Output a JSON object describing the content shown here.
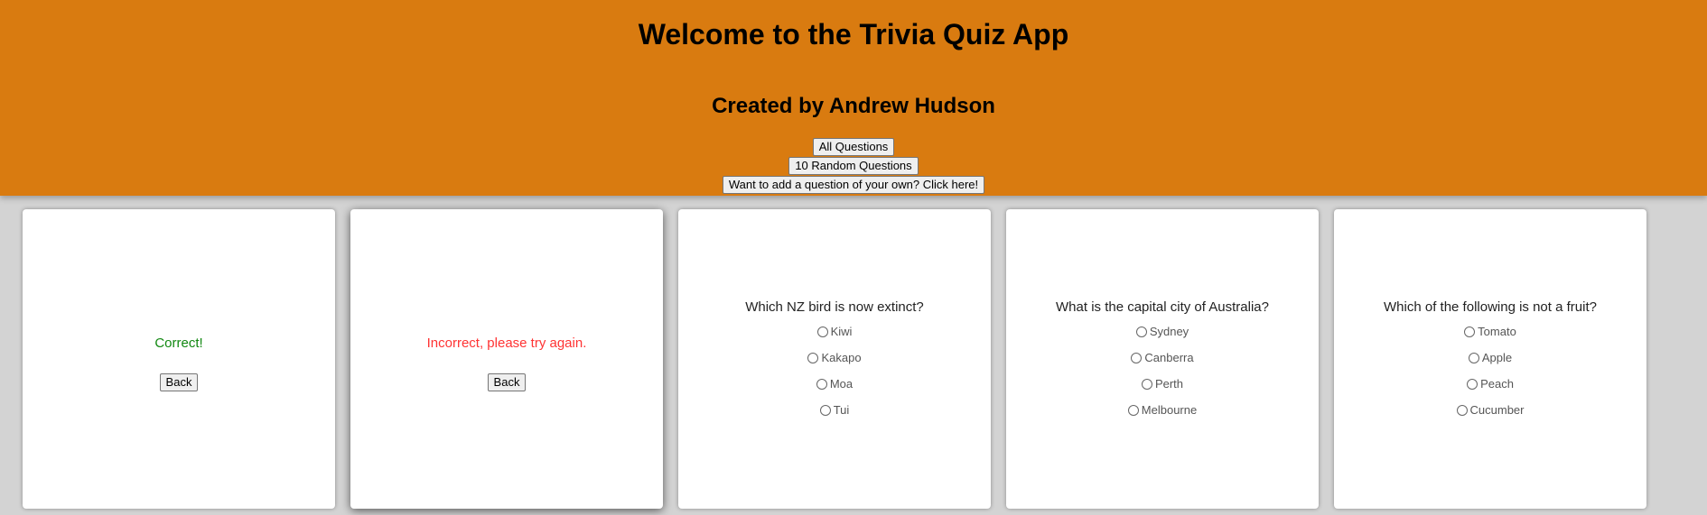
{
  "header": {
    "title": "Welcome to the Trivia Quiz App",
    "subtitle": "Created by Andrew Hudson",
    "buttons": [
      "All Questions",
      "10 Random Questions",
      "Want to add a question of your own? Click here!"
    ]
  },
  "colors": {
    "header_bg": "#d97b10",
    "page_bg": "#d3d3d3",
    "correct": "#118811",
    "incorrect": "#ff3333"
  },
  "cards": [
    {
      "result": "Correct!",
      "back": "Back"
    },
    {
      "result": "Incorrect, please try again.",
      "back": "Back"
    },
    {
      "question": "Which NZ bird is now extinct?",
      "options": [
        "Kiwi",
        "Kakapo",
        "Moa",
        "Tui"
      ]
    },
    {
      "question": "What is the capital city of Australia?",
      "options": [
        "Sydney",
        "Canberra",
        "Perth",
        "Melbourne"
      ]
    },
    {
      "question": "Which of the following is not a fruit?",
      "options": [
        "Tomato",
        "Apple",
        "Peach",
        "Cucumber"
      ]
    }
  ]
}
